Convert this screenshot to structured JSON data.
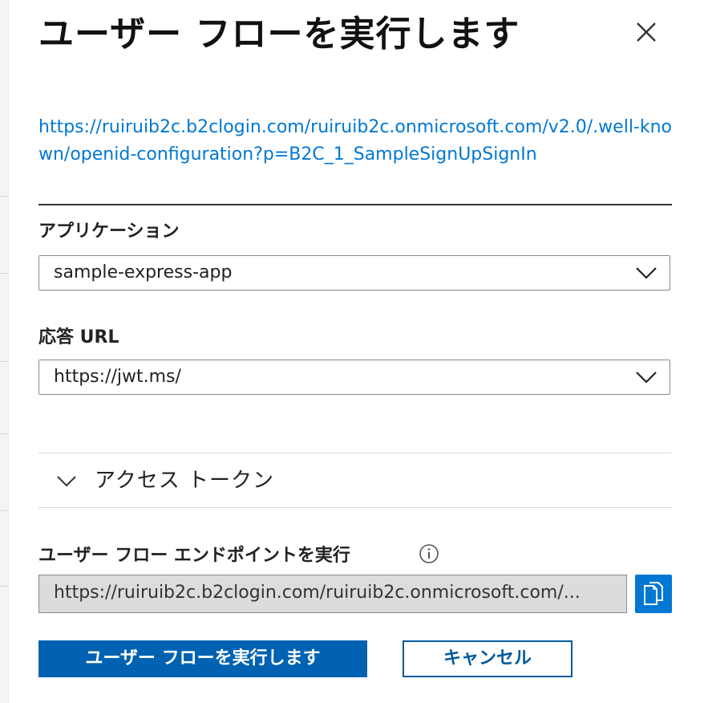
{
  "panel": {
    "title": "ユーザー フローを実行します",
    "close_icon": "close-icon"
  },
  "metadata_link": "https://ruiruib2c.b2clogin.com/ruiruib2c.onmicrosoft.com/v2.0/.well-known/openid-configuration?p=B2C_1_SampleSignUpSignIn",
  "application": {
    "label": "アプリケーション",
    "value": "sample-express-app"
  },
  "reply_url": {
    "label": "応答 URL",
    "value": "https://jwt.ms/"
  },
  "access_token": {
    "label": "アクセス トークン",
    "expanded": false
  },
  "endpoint": {
    "label": "ユーザー フロー エンドポイントを実行",
    "value": "https://ruiruib2c.b2clogin.com/ruiruib2c.onmicrosoft.com/..."
  },
  "buttons": {
    "run": "ユーザー フローを実行します",
    "cancel": "キャンセル"
  },
  "colors": {
    "link": "#0078d4",
    "primary": "#0062b1",
    "copy_button": "#0078d4"
  }
}
